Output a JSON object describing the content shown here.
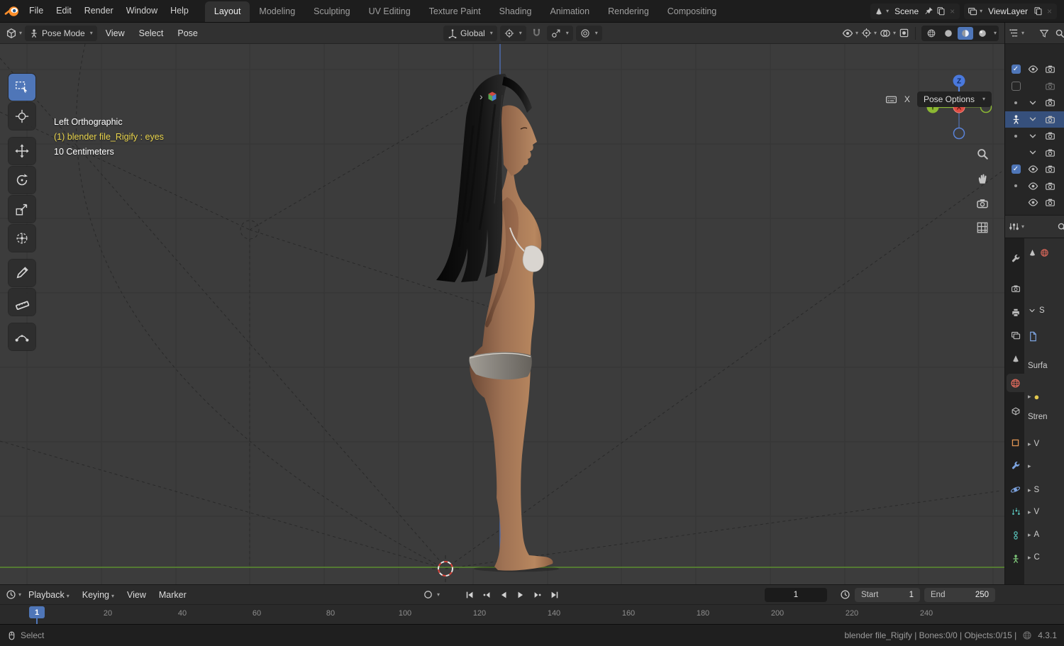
{
  "topbar": {
    "menus": [
      "File",
      "Edit",
      "Render",
      "Window",
      "Help"
    ],
    "tabs": [
      {
        "label": "Layout",
        "active": true
      },
      {
        "label": "Modeling"
      },
      {
        "label": "Sculpting"
      },
      {
        "label": "UV Editing"
      },
      {
        "label": "Texture Paint"
      },
      {
        "label": "Shading"
      },
      {
        "label": "Animation"
      },
      {
        "label": "Rendering"
      },
      {
        "label": "Compositing"
      }
    ],
    "scene_selector": {
      "value": "Scene"
    },
    "viewlayer_selector": {
      "value": "ViewLayer"
    }
  },
  "viewport_header": {
    "mode_selector": "Pose Mode",
    "menus": [
      "View",
      "Select",
      "Pose"
    ],
    "orientation_selector": "Global"
  },
  "tools": [
    "select-box",
    "cursor",
    "move",
    "rotate",
    "scale",
    "transform",
    "annotate",
    "measure",
    "pose-breakdowner"
  ],
  "viewport": {
    "view_label": "Left Orthographic",
    "active_object_label": "(1) blender file_Rigify : eyes",
    "grid_scale_label": "10 Centimeters",
    "pose_options_label": "Pose Options",
    "shortcut_label": "X",
    "axis_labels": {
      "x": "X",
      "y": "Y",
      "z": "Z"
    }
  },
  "outliner": {
    "rows": [
      {
        "icons": [
          "checkbox-checked",
          "eye",
          "camera"
        ]
      },
      {
        "icons": [
          "checkbox-empty",
          "camera"
        ]
      },
      {
        "icons": [
          "dot",
          "chevron",
          "camera"
        ]
      },
      {
        "icons": [
          "armature",
          "chevron",
          "camera"
        ],
        "selected": true
      },
      {
        "icons": [
          "dot",
          "chevron",
          "camera"
        ]
      },
      {
        "icons": [
          "chevron",
          "camera"
        ]
      },
      {
        "icons": [
          "checkbox-checked",
          "eye",
          "camera"
        ]
      },
      {
        "icons": [
          "dot",
          "eye",
          "camera"
        ]
      },
      {
        "icons": [
          "eye",
          "camera"
        ]
      }
    ]
  },
  "properties": {
    "active_tab": "world",
    "tabs": [
      "tool",
      "render",
      "output",
      "view-layer",
      "scene",
      "world",
      "collection",
      "object",
      "modifiers",
      "physics",
      "particles",
      "constraints",
      "object-data"
    ],
    "fragments": {
      "panel_letter": "S",
      "surface_label": "Surfa",
      "strength_label": "Stren",
      "collapsed": [
        "V",
        "",
        "S",
        "V",
        "A",
        "C"
      ]
    }
  },
  "timeline": {
    "menus": [
      "Playback",
      "Keying",
      "View",
      "Marker"
    ],
    "current_frame": "1",
    "start_label": "Start",
    "start_value": "1",
    "end_label": "End",
    "end_value": "250",
    "marker_frame": "1",
    "ruler_labels": [
      "20",
      "40",
      "60",
      "80",
      "100",
      "120",
      "140",
      "160",
      "180",
      "200",
      "220",
      "240"
    ]
  },
  "statusbar": {
    "left_label": "Select",
    "scene_info": "blender file_Rigify | Bones:0/0 | Objects:0/15 |",
    "version": "4.3.1"
  },
  "colors": {
    "accent": "#4f76b8",
    "highlight_text": "#e8d34b",
    "axis_x": "#dd4b41",
    "axis_y": "#8cb833",
    "axis_z": "#4a79dd",
    "ground_line": "#5d8f2f"
  }
}
